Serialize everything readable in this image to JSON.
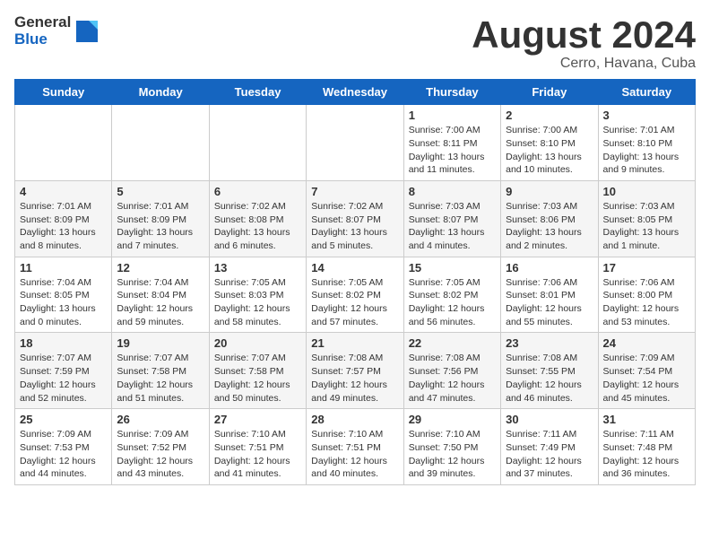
{
  "logo": {
    "general": "General",
    "blue": "Blue"
  },
  "title": "August 2024",
  "subtitle": "Cerro, Havana, Cuba",
  "days_header": [
    "Sunday",
    "Monday",
    "Tuesday",
    "Wednesday",
    "Thursday",
    "Friday",
    "Saturday"
  ],
  "weeks": [
    [
      {
        "day": "",
        "info": ""
      },
      {
        "day": "",
        "info": ""
      },
      {
        "day": "",
        "info": ""
      },
      {
        "day": "",
        "info": ""
      },
      {
        "day": "1",
        "info": "Sunrise: 7:00 AM\nSunset: 8:11 PM\nDaylight: 13 hours and 11 minutes."
      },
      {
        "day": "2",
        "info": "Sunrise: 7:00 AM\nSunset: 8:10 PM\nDaylight: 13 hours and 10 minutes."
      },
      {
        "day": "3",
        "info": "Sunrise: 7:01 AM\nSunset: 8:10 PM\nDaylight: 13 hours and 9 minutes."
      }
    ],
    [
      {
        "day": "4",
        "info": "Sunrise: 7:01 AM\nSunset: 8:09 PM\nDaylight: 13 hours and 8 minutes."
      },
      {
        "day": "5",
        "info": "Sunrise: 7:01 AM\nSunset: 8:09 PM\nDaylight: 13 hours and 7 minutes."
      },
      {
        "day": "6",
        "info": "Sunrise: 7:02 AM\nSunset: 8:08 PM\nDaylight: 13 hours and 6 minutes."
      },
      {
        "day": "7",
        "info": "Sunrise: 7:02 AM\nSunset: 8:07 PM\nDaylight: 13 hours and 5 minutes."
      },
      {
        "day": "8",
        "info": "Sunrise: 7:03 AM\nSunset: 8:07 PM\nDaylight: 13 hours and 4 minutes."
      },
      {
        "day": "9",
        "info": "Sunrise: 7:03 AM\nSunset: 8:06 PM\nDaylight: 13 hours and 2 minutes."
      },
      {
        "day": "10",
        "info": "Sunrise: 7:03 AM\nSunset: 8:05 PM\nDaylight: 13 hours and 1 minute."
      }
    ],
    [
      {
        "day": "11",
        "info": "Sunrise: 7:04 AM\nSunset: 8:05 PM\nDaylight: 13 hours and 0 minutes."
      },
      {
        "day": "12",
        "info": "Sunrise: 7:04 AM\nSunset: 8:04 PM\nDaylight: 12 hours and 59 minutes."
      },
      {
        "day": "13",
        "info": "Sunrise: 7:05 AM\nSunset: 8:03 PM\nDaylight: 12 hours and 58 minutes."
      },
      {
        "day": "14",
        "info": "Sunrise: 7:05 AM\nSunset: 8:02 PM\nDaylight: 12 hours and 57 minutes."
      },
      {
        "day": "15",
        "info": "Sunrise: 7:05 AM\nSunset: 8:02 PM\nDaylight: 12 hours and 56 minutes."
      },
      {
        "day": "16",
        "info": "Sunrise: 7:06 AM\nSunset: 8:01 PM\nDaylight: 12 hours and 55 minutes."
      },
      {
        "day": "17",
        "info": "Sunrise: 7:06 AM\nSunset: 8:00 PM\nDaylight: 12 hours and 53 minutes."
      }
    ],
    [
      {
        "day": "18",
        "info": "Sunrise: 7:07 AM\nSunset: 7:59 PM\nDaylight: 12 hours and 52 minutes."
      },
      {
        "day": "19",
        "info": "Sunrise: 7:07 AM\nSunset: 7:58 PM\nDaylight: 12 hours and 51 minutes."
      },
      {
        "day": "20",
        "info": "Sunrise: 7:07 AM\nSunset: 7:58 PM\nDaylight: 12 hours and 50 minutes."
      },
      {
        "day": "21",
        "info": "Sunrise: 7:08 AM\nSunset: 7:57 PM\nDaylight: 12 hours and 49 minutes."
      },
      {
        "day": "22",
        "info": "Sunrise: 7:08 AM\nSunset: 7:56 PM\nDaylight: 12 hours and 47 minutes."
      },
      {
        "day": "23",
        "info": "Sunrise: 7:08 AM\nSunset: 7:55 PM\nDaylight: 12 hours and 46 minutes."
      },
      {
        "day": "24",
        "info": "Sunrise: 7:09 AM\nSunset: 7:54 PM\nDaylight: 12 hours and 45 minutes."
      }
    ],
    [
      {
        "day": "25",
        "info": "Sunrise: 7:09 AM\nSunset: 7:53 PM\nDaylight: 12 hours and 44 minutes."
      },
      {
        "day": "26",
        "info": "Sunrise: 7:09 AM\nSunset: 7:52 PM\nDaylight: 12 hours and 43 minutes."
      },
      {
        "day": "27",
        "info": "Sunrise: 7:10 AM\nSunset: 7:51 PM\nDaylight: 12 hours and 41 minutes."
      },
      {
        "day": "28",
        "info": "Sunrise: 7:10 AM\nSunset: 7:51 PM\nDaylight: 12 hours and 40 minutes."
      },
      {
        "day": "29",
        "info": "Sunrise: 7:10 AM\nSunset: 7:50 PM\nDaylight: 12 hours and 39 minutes."
      },
      {
        "day": "30",
        "info": "Sunrise: 7:11 AM\nSunset: 7:49 PM\nDaylight: 12 hours and 37 minutes."
      },
      {
        "day": "31",
        "info": "Sunrise: 7:11 AM\nSunset: 7:48 PM\nDaylight: 12 hours and 36 minutes."
      }
    ]
  ]
}
